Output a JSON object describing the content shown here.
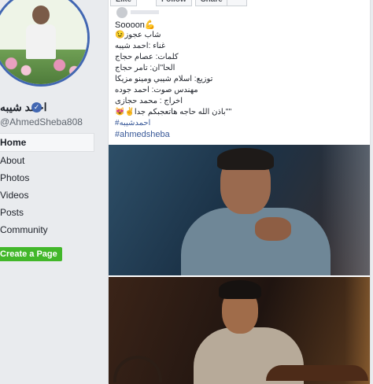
{
  "profile": {
    "name": "احمد شيبه",
    "handle": "@AhmedSheba808"
  },
  "nav": {
    "items": [
      {
        "label": "Home",
        "active": true
      },
      {
        "label": "About",
        "active": false
      },
      {
        "label": "Photos",
        "active": false
      },
      {
        "label": "Videos",
        "active": false
      },
      {
        "label": "Posts",
        "active": false
      },
      {
        "label": "Community",
        "active": false
      }
    ],
    "create_page": "Create a Page"
  },
  "post": {
    "top_actions": [
      "Like",
      "Follow",
      "Share"
    ],
    "lines": [
      "Soooon💪",
      "😉شاب عجوز",
      "غناء :احمد شيبه",
      "كلمات: عصام حجاج",
      "الحا''ان: تامر حجاج",
      "توزيع: اسلام شيبي ومينو مزيكا",
      "مهندس صوت: احمد جوده",
      "اخراج : محمد حجازى",
      "😻✌باذن الله حاجه هاتعجبكم جدا''''",
      "#احمدشيبه",
      "#ahmedsheba"
    ]
  },
  "colors": {
    "accent": "#4267b2",
    "link": "#385898",
    "create_button": "#42b72a",
    "background": "#e9ebee"
  }
}
